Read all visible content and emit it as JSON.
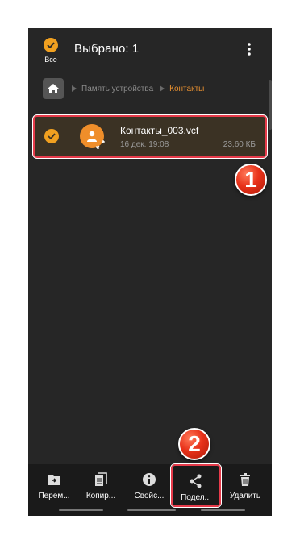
{
  "header": {
    "select_all_label": "Все",
    "title": "Выбрано: 1"
  },
  "breadcrumb": {
    "items": [
      "Память устройства",
      "Контакты"
    ]
  },
  "file": {
    "name": "Контакты_003.vcf",
    "date": "16 дек. 19:08",
    "size": "23,60 КБ"
  },
  "markers": [
    "1",
    "2"
  ],
  "bottom_bar": {
    "items": [
      "Перем...",
      "Копир...",
      "Свойс...",
      "Подел...",
      "Удалить"
    ]
  },
  "colors": {
    "accent": "#f0a020",
    "highlight": "#e63a4a",
    "background": "#262626"
  }
}
